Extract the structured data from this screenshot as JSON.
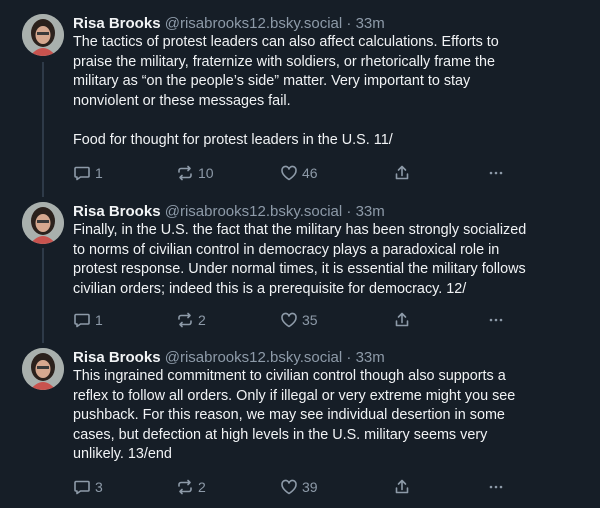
{
  "posts": [
    {
      "author": {
        "name": "Risa Brooks",
        "handle": "@risabrooks12.bsky.social"
      },
      "separator": " · ",
      "time": "33m",
      "paragraphs": [
        "The tactics of protest leaders can also affect calculations. Efforts to\npraise the military, fraternize with soldiers, or rhetorically frame the\nmilitary as “on the people’s side” matter. Very important to stay\nnonviolent or these messages fail.",
        "Food for thought for protest leaders in the U.S. 11/"
      ],
      "replies": "1",
      "reposts": "10",
      "likes": "46"
    },
    {
      "author": {
        "name": "Risa Brooks",
        "handle": "@risabrooks12.bsky.social"
      },
      "separator": " · ",
      "time": "33m",
      "paragraphs": [
        "Finally, in the U.S. the fact that the military has been strongly socialized\nto norms of civilian control in democracy plays a paradoxical role in\nprotest response. Under normal times, it is essential the military follows\ncivilian orders; indeed this is a prerequisite for democracy.   12/"
      ],
      "replies": "1",
      "reposts": "2",
      "likes": "35"
    },
    {
      "author": {
        "name": "Risa Brooks",
        "handle": "@risabrooks12.bsky.social"
      },
      "separator": " · ",
      "time": "33m",
      "paragraphs": [
        "This ingrained commitment to civilian control though also supports a\nreflex to follow all orders. Only if illegal or very extreme might you see\npushback. For this reason, we may see individual desertion in some\ncases, but defection at high levels in the U.S. military seems very\nunlikely. 13/end"
      ],
      "replies": "3",
      "reposts": "2",
      "likes": "39"
    }
  ],
  "icons": {
    "reply": "reply-icon",
    "repost": "repost-icon",
    "like": "heart-icon",
    "share": "share-icon",
    "more": "more-options-icon",
    "avatar": "avatar"
  },
  "colors": {
    "background": "#161e27",
    "text": "#f1f3f5",
    "muted": "#8d9aa8",
    "thread_line": "#2e3a48"
  }
}
